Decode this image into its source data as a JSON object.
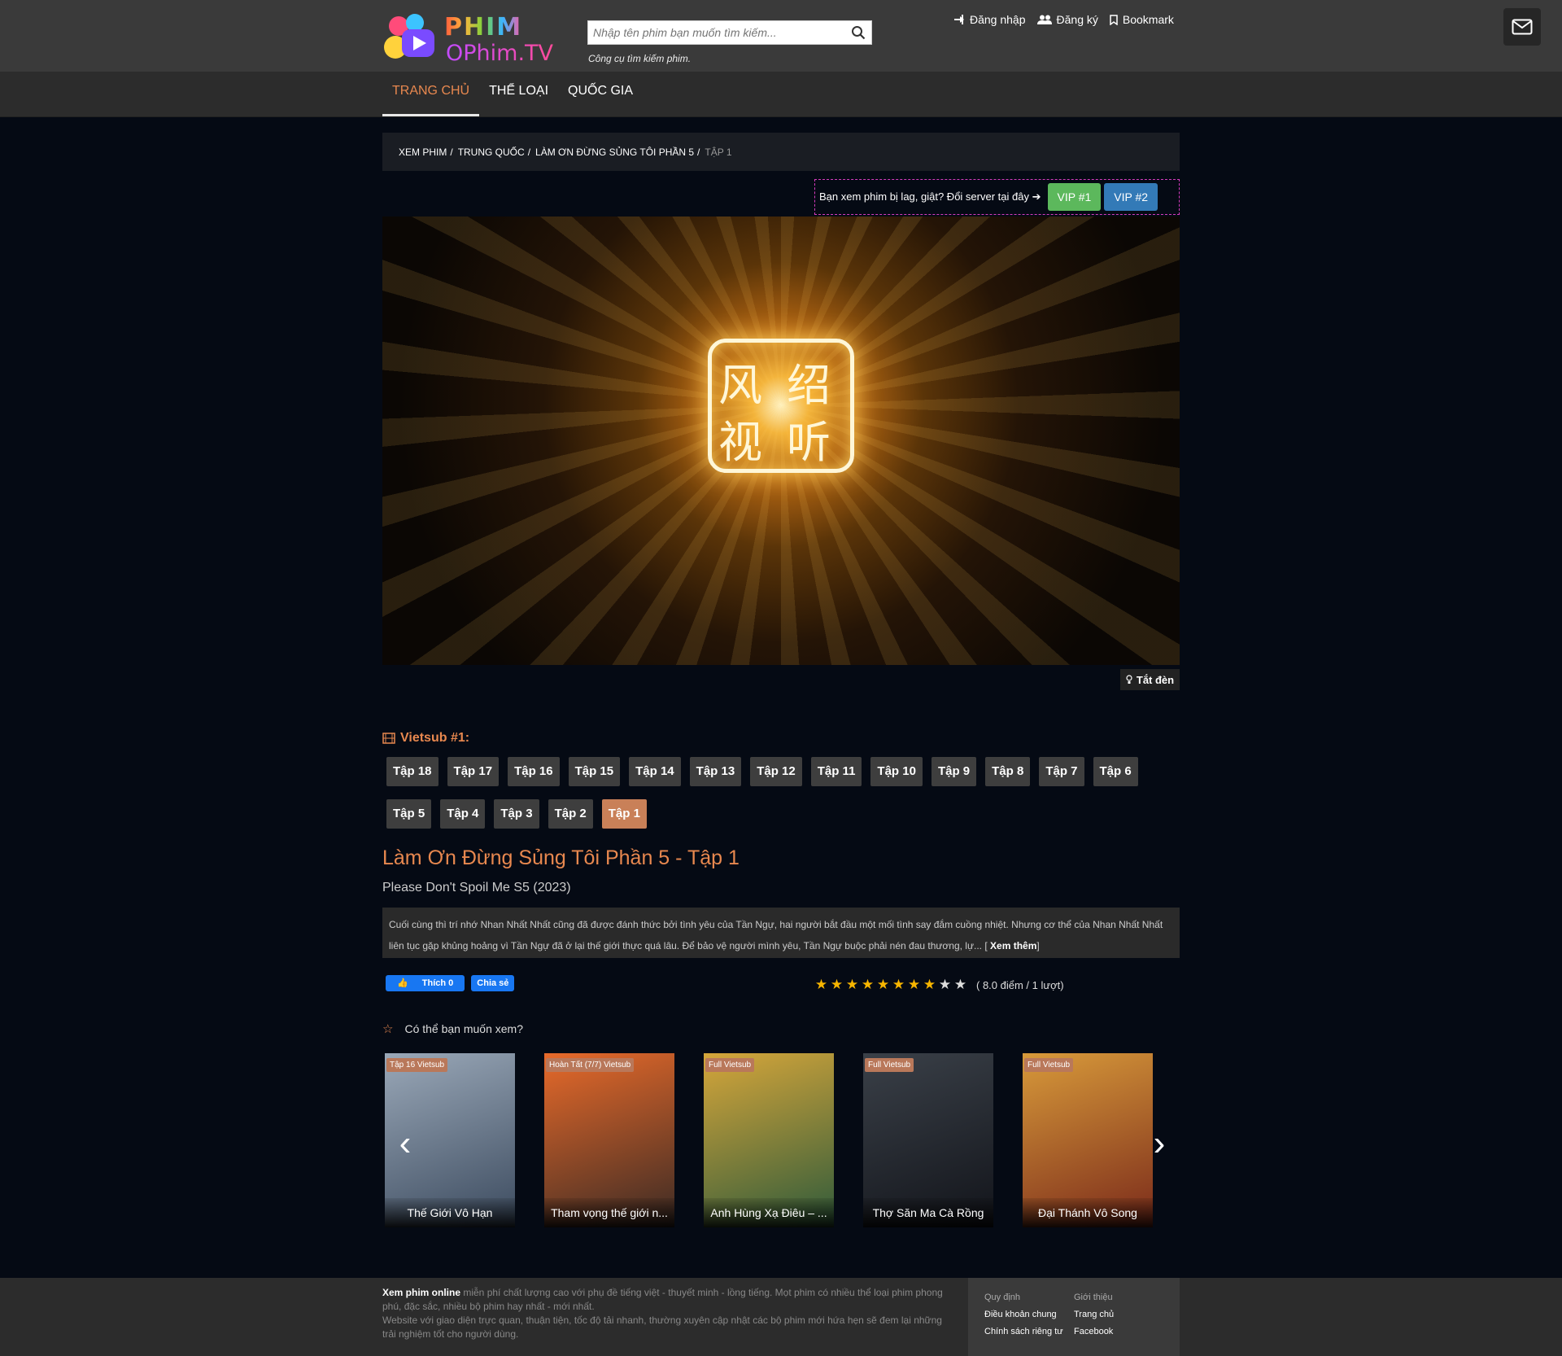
{
  "header": {
    "logo_top": "PHIM",
    "logo_bottom": "OPhim.TV",
    "search_placeholder": "Nhập tên phim bạn muốn tìm kiếm...",
    "search_hint": "Công cụ tìm kiếm phim.",
    "links": {
      "login": "Đăng nhập",
      "register": "Đăng ký",
      "bookmark": "Bookmark"
    }
  },
  "nav": {
    "home": "TRANG CHỦ",
    "genre": "THỂ LOẠI",
    "country": "QUỐC GIA"
  },
  "breadcrumb": {
    "item1": "XEM PHIM",
    "item2": "TRUNG QUỐC",
    "item3": "LÀM ƠN ĐỪNG SỦNG TÔI PHẦN 5",
    "current": "TẬP 1",
    "sep": "/"
  },
  "server": {
    "text": "Bạn xem phim bị lag, giật? Đổi server tại đây",
    "vip1": "VIP #1",
    "vip2": "VIP #2"
  },
  "player": {
    "lights_label": "Tắt đèn"
  },
  "episodes": {
    "title": "Vietsub #1:",
    "list": [
      "Tập 18",
      "Tập 17",
      "Tập 16",
      "Tập 15",
      "Tập 14",
      "Tập 13",
      "Tập 12",
      "Tập 11",
      "Tập 10",
      "Tập 9",
      "Tập 8",
      "Tập 7",
      "Tập 6",
      "Tập 5",
      "Tập 4",
      "Tập 3",
      "Tập 2",
      "Tập 1"
    ],
    "active": "Tập 1"
  },
  "movie": {
    "title": "Làm Ơn Đừng Sủng Tôi Phần 5  -  Tập 1",
    "subtitle": "Please Don't Spoil Me S5 (2023)",
    "description": "Cuối cùng thì trí nhớ Nhan Nhất Nhất cũng đã được đánh thức bởi tình yêu của Tần Ngự, hai người bắt đầu một mối tình say đắm cuồng nhiệt. Nhưng cơ thể của Nhan Nhất Nhất liên tục gặp khủng hoảng vì Tần Ngự đã ở lại thế giới thực quá lâu. Để bảo vệ người mình yêu, Tần Ngự buộc phải nén đau thương, lự...",
    "more_prefix": " [ ",
    "more": "Xem thêm",
    "more_suffix": "]"
  },
  "social": {
    "like": "Thích 0",
    "share": "Chia sẻ"
  },
  "rating": {
    "score": 8,
    "max": 10,
    "text": "( 8.0 điểm / 1 lượt)"
  },
  "recommend": {
    "title": "Có thể bạn muốn xem?",
    "items": [
      {
        "badge": "Tập 16 Vietsub",
        "name": "Thế Giới Vô Hạn",
        "c1": "#9aa8b8",
        "c2": "#3b4a5e"
      },
      {
        "badge": "Hoàn Tất (7/7) Vietsub",
        "name": "Tham vọng thế giới n...",
        "c1": "#e86a2a",
        "c2": "#3a2a24"
      },
      {
        "badge": "Full Vietsub",
        "name": "Anh Hùng Xạ Điêu – ...",
        "c1": "#d6a63a",
        "c2": "#2e5a3a"
      },
      {
        "badge": "Full Vietsub",
        "name": "Thợ Săn Ma Cà Rồng",
        "c1": "#3a4048",
        "c2": "#12141a"
      },
      {
        "badge": "Full Vietsub",
        "name": "Đại Thánh Vô Song",
        "c1": "#d89a3a",
        "c2": "#7a2a1a"
      }
    ]
  },
  "footer": {
    "bold": "Xem phim online",
    "text1": " miễn phí chất lượng cao với phụ đề tiếng việt - thuyết minh - lồng tiếng. Mọt phim có nhiều thể loại phim phong phú, đặc sắc, nhiều bộ phim hay nhất - mới nhất.",
    "text2": "Website với giao diện trực quan, thuận tiện, tốc độ tải nhanh, thường xuyên cập nhật các bộ phim mới hứa hẹn sẽ đem lại những trải nghiệm tốt cho người dùng.",
    "col1_h": "Quy định",
    "col1_a": "Điều khoản chung",
    "col1_b": "Chính sách riêng tư",
    "col2_h": "Giới thiệu",
    "col2_a": "Trang chủ",
    "col2_b": "Facebook"
  },
  "colors": {
    "accent": "#e8884f",
    "vip1": "#5cb85c",
    "vip2": "#337ab7",
    "active_ep": "#c98058"
  }
}
